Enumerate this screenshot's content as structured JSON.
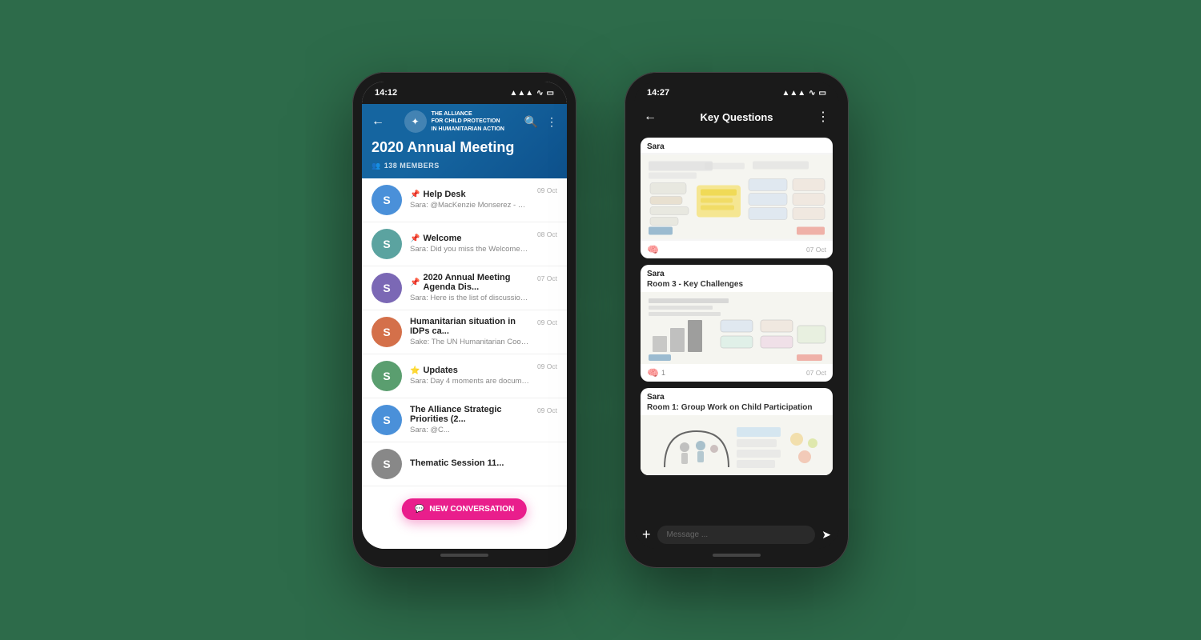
{
  "background": "#2d6b4a",
  "phone1": {
    "status_bar": {
      "time": "14:12",
      "signal": "▲▲▲",
      "wifi": "wifi",
      "battery": "battery"
    },
    "header": {
      "logo_text_line1": "THE ALLIANCE",
      "logo_text_line2": "FOR CHILD PROTECTION",
      "logo_text_line3": "IN HUMANITARIAN ACTION",
      "title": "2020 Annual Meeting",
      "members_count": "138 MEMBERS",
      "back_label": "←",
      "search_label": "🔍",
      "more_label": "⋮"
    },
    "channels": [
      {
        "name": "Help Desk",
        "preview": "Sara: @MacKenzie Monserez - did it g...",
        "date": "09 Oct",
        "pinned": true,
        "avatar_color": "av-blue"
      },
      {
        "name": "Welcome",
        "preview": "Sara: Did you miss the Welcome sessio...",
        "date": "08 Oct",
        "pinned": true,
        "avatar_color": "av-teal"
      },
      {
        "name": "2020 Annual Meeting Agenda Dis...",
        "preview": "Sara: Here is the list of discussions thr...",
        "date": "07 Oct",
        "pinned": true,
        "avatar_color": "av-purple"
      },
      {
        "name": "Humanitarian situation in IDPs ca...",
        "preview": "Sake: The UN Humanitarian Coordinat...",
        "date": "09 Oct",
        "pinned": false,
        "avatar_color": "av-orange"
      },
      {
        "name": "Updates",
        "preview": "Sara: Day 4 moments are documented...",
        "date": "09 Oct",
        "pinned": false,
        "star": true,
        "avatar_color": "av-green"
      },
      {
        "name": "The Alliance Strategic Priorities (2...",
        "preview": "Sara: @C...",
        "date": "09 Oct",
        "pinned": false,
        "avatar_color": "av-blue"
      },
      {
        "name": "Thematic Session 11...",
        "preview": "",
        "date": "",
        "pinned": false,
        "avatar_color": "av-gray"
      }
    ],
    "new_conversation_label": "NEW CONVERSATION"
  },
  "phone2": {
    "status_bar": {
      "time": "14:27",
      "signal": "▲▲▲",
      "wifi": "wifi",
      "battery": "battery"
    },
    "header": {
      "back_label": "←",
      "title": "Key Questions",
      "more_label": "⋮"
    },
    "messages": [
      {
        "sender": "Sara",
        "subtitle": null,
        "image_label": "sketch_questions",
        "reaction": "🧠",
        "reaction_count": null,
        "date": "07 Oct"
      },
      {
        "sender": "Sara",
        "subtitle": "Room 3 - Key Challenges",
        "image_label": "sketch_challenges",
        "reaction": "🧠",
        "reaction_count": "1",
        "date": "07 Oct"
      },
      {
        "sender": "Sara",
        "subtitle": "Room 1: Group Work on Child Participation",
        "image_label": "sketch_child",
        "reaction": null,
        "reaction_count": null,
        "date": null
      }
    ],
    "input": {
      "placeholder": "Message ...",
      "plus_label": "+",
      "send_label": "➤"
    }
  }
}
